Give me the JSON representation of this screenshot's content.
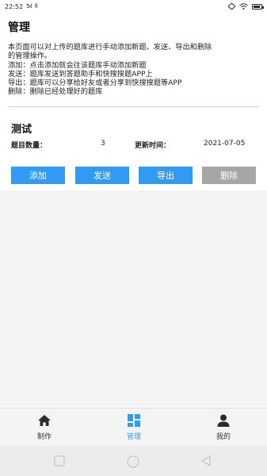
{
  "status": {
    "time": "22:52",
    "signal": "5ıl",
    "app_glyph": "fi"
  },
  "page": {
    "title": "管理",
    "description_lines": [
      "本页面可以对上传的题库进行手动添加新题、发送、导出和删除",
      "的管理操作。",
      "添加：点击添加就会往该题库手动添加新题",
      "发送：题库发送到答题助手和快搜搜题APP上",
      "导出：题库可以分享给好友或者分享到快搜搜题等APP",
      "删除：删除已经处理好的题库"
    ]
  },
  "bank": {
    "name": "测试",
    "count_label": "题目数量：",
    "count_value": "3",
    "updated_label": "更新时间：",
    "updated_value": "2021-07-05",
    "actions": {
      "add": "添加",
      "send": "发送",
      "export": "导出",
      "delete": "删除"
    }
  },
  "tabs": {
    "make": "制作",
    "manage": "管理",
    "mine": "我的"
  },
  "colors": {
    "accent": "#2f9bf4",
    "delete_button": "#a6a6a6"
  }
}
